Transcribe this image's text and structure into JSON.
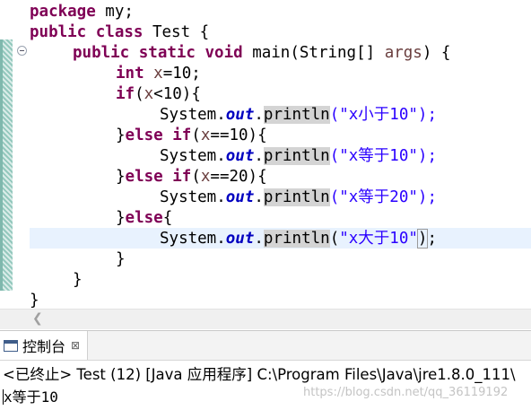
{
  "editor": {
    "lines": [
      {
        "t1": "package",
        "t2": " my;"
      },
      {
        "t1": "public class",
        "t2": " Test {"
      },
      {
        "t1": "public static void",
        "t2": " main(String[] ",
        "t3": "args",
        "t4": ") {"
      },
      {
        "t1": "int",
        "t2": " ",
        "t3": "x",
        "t4": "=10;"
      },
      {
        "t1": "if",
        "t2": "(",
        "t3": "x",
        "t4": "<10){"
      },
      {
        "p1": "System.",
        "f": "out",
        "p2": ".",
        "m": "println",
        "s": "(\"x小于10\");"
      },
      {
        "t0": "}",
        "t1": "else if",
        "t2": "(",
        "t3": "x",
        "t4": "==10){"
      },
      {
        "p1": "System.",
        "f": "out",
        "p2": ".",
        "m": "println",
        "s": "(\"x等于10\");"
      },
      {
        "t0": "}",
        "t1": "else if",
        "t2": "(",
        "t3": "x",
        "t4": "==20){"
      },
      {
        "p1": "System.",
        "f": "out",
        "p2": ".",
        "m": "println",
        "s": "(\"x等于20\");"
      },
      {
        "t0": "}",
        "t1": "else",
        "t2": "{"
      },
      {
        "p1": "System.",
        "f": "out",
        "p2": ".",
        "m": "println",
        "s1": "(",
        "str": "\"x大于10\"",
        "s2": ")",
        "s3": ";"
      },
      {
        "t0": "}"
      },
      {
        "t0": "}"
      },
      {
        "t0": "}"
      }
    ]
  },
  "console": {
    "tab_label": "控制台",
    "tab_close": "⊠",
    "terminated_line": "<已终止> Test (12) [Java 应用程序] C:\\Program Files\\Java\\jre1.8.0_111\\",
    "output": "x等于10"
  },
  "watermark": "https://blog.csdn.net/qq_36119192"
}
